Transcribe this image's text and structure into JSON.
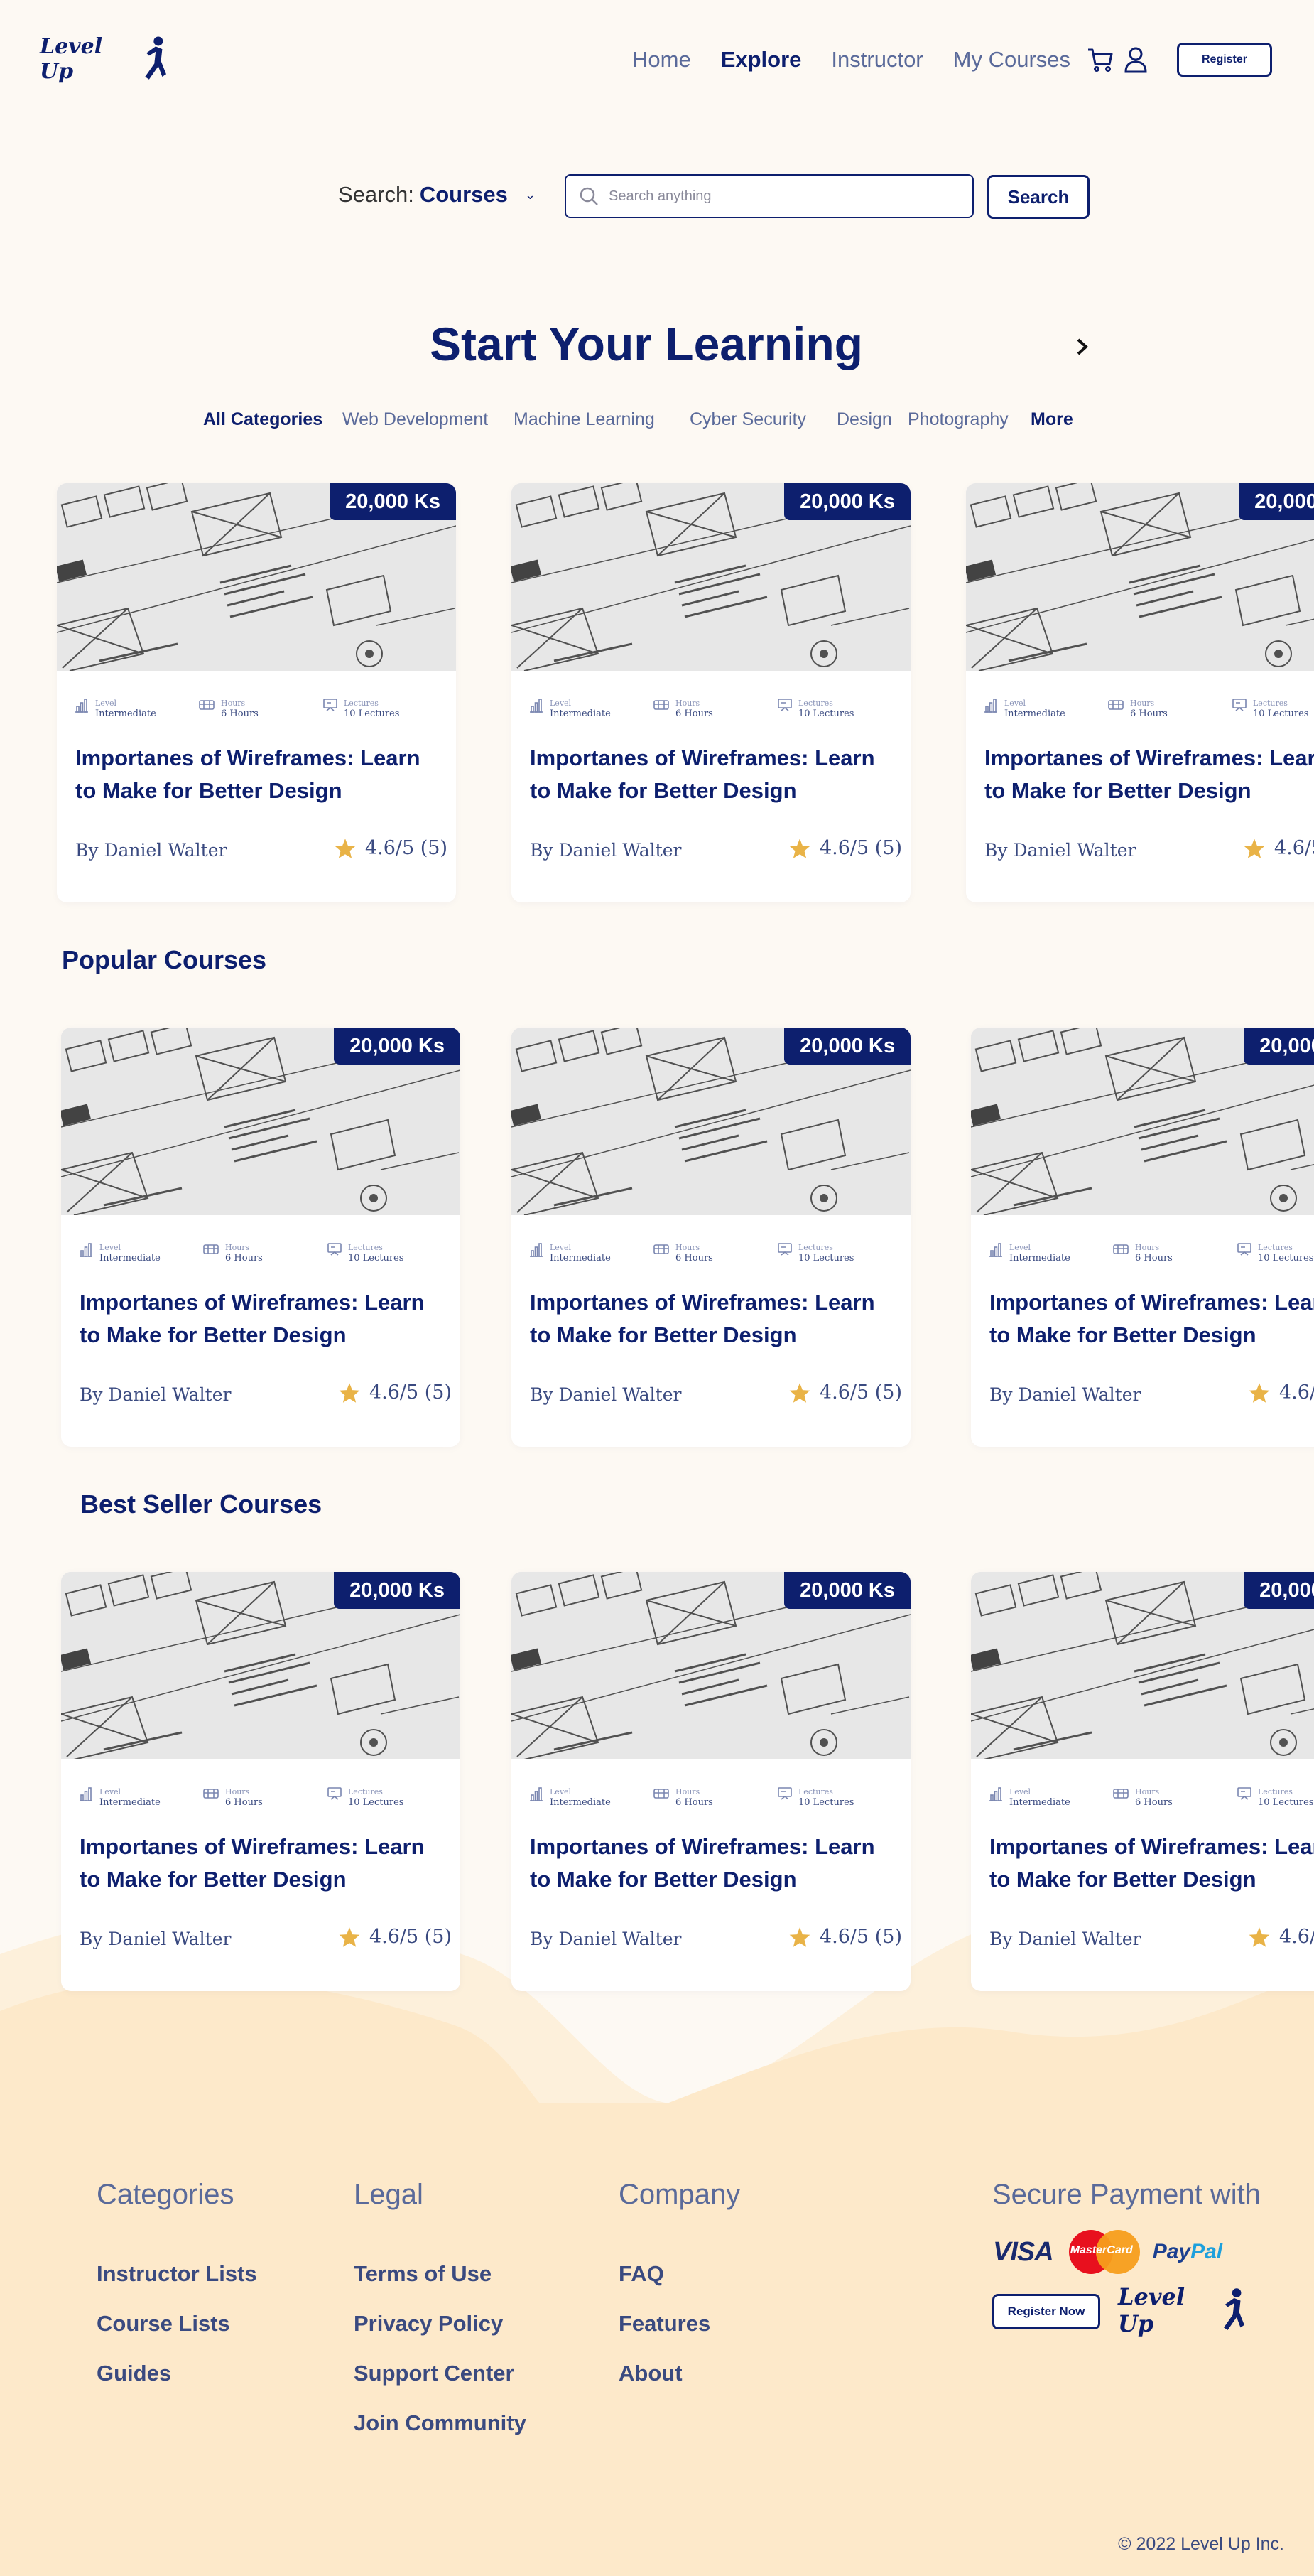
{
  "header": {
    "logo_text": "Level Up",
    "nav": [
      "Home",
      "Explore",
      "Instructor",
      "My Courses"
    ],
    "active_nav": "Explore",
    "register_label": "Register"
  },
  "search": {
    "label": "Search:",
    "scope": "Courses",
    "placeholder": "Search anything",
    "button_label": "Search"
  },
  "hero": {
    "title": "Start Your Learning",
    "categories": [
      "All Categories",
      "Web Development",
      "Machine Learning",
      "Cyber Security",
      "Design",
      "Photography",
      "More"
    ]
  },
  "sections": {
    "popular_title": "Popular Courses",
    "bestseller_title": "Best Seller Courses"
  },
  "course": {
    "price": "20,000 Ks",
    "level_label": "Level",
    "level": "Intermediate",
    "hours_label": "Hours",
    "hours": "6 Hours",
    "lectures_label": "Lectures",
    "lectures": "10 Lectures",
    "title": "Importanes of Wireframes: Learn to Make for Better Design",
    "author": "By Daniel Walter",
    "rating": "4.6/5 (5)"
  },
  "footer": {
    "categories": {
      "title": "Categories",
      "links": [
        "Instructor Lists",
        "Course Lists",
        "Guides"
      ]
    },
    "legal": {
      "title": "Legal",
      "links": [
        "Terms of Use",
        "Privacy Policy",
        "Support Center",
        "Join Community"
      ]
    },
    "company": {
      "title": "Company",
      "links": [
        "FAQ",
        "Features",
        "About"
      ]
    },
    "payment": {
      "title": "Secure Payment with",
      "visa": "VISA",
      "mastercard": "MasterCard",
      "paypal_pay": "Pay",
      "paypal_pal": "Pal",
      "register_now": "Register Now",
      "logo_text": "Level Up"
    },
    "copyright": "© 2022 Level Up Inc."
  },
  "colors": {
    "primary": "#0d1f6e",
    "background": "#fdf9f3",
    "footer": "#fdeacc",
    "star": "#e9b347"
  }
}
